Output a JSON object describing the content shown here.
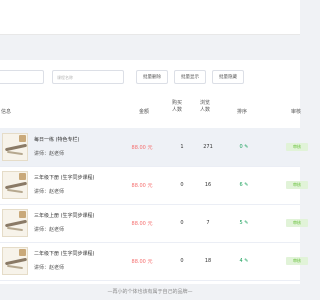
{
  "toolbar": {
    "search_placeholder": "课程名称",
    "btn_batch_delete": "批量删除",
    "btn_batch_show": "批量显示",
    "btn_batch_hide": "批量隐藏"
  },
  "table": {
    "headers": {
      "info": "信息",
      "amount": "金额",
      "buyers": "购买人数",
      "views": "浏览人数",
      "sort": "排序",
      "review": "审核"
    },
    "rows": [
      {
        "title": "每日一练 (特色专栏)",
        "teacher": "讲师：赵老师",
        "price": "88.00 元",
        "buyers": "1",
        "views": "271",
        "sort": "0",
        "status": "审核"
      },
      {
        "title": "三年级下册 (生字同步课程)",
        "teacher": "讲师：赵老师",
        "price": "88.00 元",
        "buyers": "0",
        "views": "16",
        "sort": "6",
        "status": "审核"
      },
      {
        "title": "三年级上册 (生字同步课程)",
        "teacher": "讲师：赵老师",
        "price": "88.00 元",
        "buyers": "0",
        "views": "7",
        "sort": "5",
        "status": "审核"
      },
      {
        "title": "二年级下册 (生字同步课程)",
        "teacher": "讲师：赵老师",
        "price": "88.00 元",
        "buyers": "0",
        "views": "18",
        "sort": "4",
        "status": "审核"
      }
    ]
  },
  "footer": {
    "slogan": "—再小的个体也该有属于自己的品牌—"
  },
  "colors": {
    "price": "#f56c6c",
    "sort": "#19a05a",
    "tag_bg": "#e1f3d8",
    "tag_text": "#67c23a"
  },
  "icons": {
    "sort_edit": "edit-icon"
  }
}
